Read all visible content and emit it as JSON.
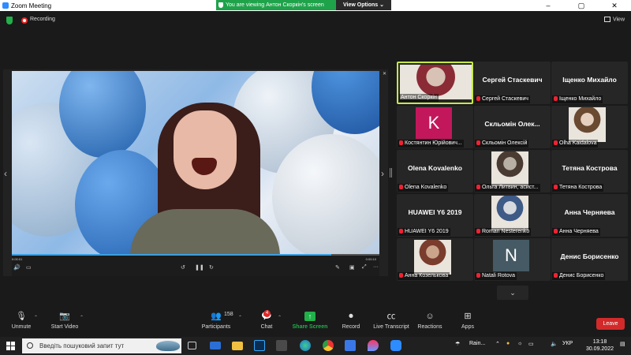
{
  "window": {
    "title": "Zoom Meeting",
    "controls": [
      "–",
      "▢",
      "✕"
    ]
  },
  "share_banner": {
    "text": "You are viewing Антон Скоркін's screen",
    "view_options": "View Options ⌄"
  },
  "topbar": {
    "recording_label": "Recording",
    "view_label": "View"
  },
  "shared_video": {
    "time_elapsed": "0:00:01",
    "time_total": "0:00:10",
    "progress_fraction": 0.87,
    "colors": {
      "progress": "#3c9fe0"
    }
  },
  "participants": [
    {
      "display": "photo",
      "footer": "Антон Скоркін",
      "active": true
    },
    {
      "display": "name",
      "big_name": "Сергей Стаскевич",
      "footer": "Сергей Стаскевич"
    },
    {
      "display": "name",
      "big_name": "Іщенко Михайло",
      "footer": "Іщенко Михайло"
    },
    {
      "display": "initial",
      "initial": "K",
      "footer": "Костянтин Юрійович...",
      "color": "#c2185b"
    },
    {
      "display": "name",
      "big_name": "Скльомін Олек...",
      "footer": "Скльомін Олексій"
    },
    {
      "display": "photo",
      "footer": "Olha Kaidalova"
    },
    {
      "display": "name",
      "big_name": "Olena Kovalenko",
      "footer": "Olena Kovalenko"
    },
    {
      "display": "photo",
      "footer": "Ольга Литвин, асист..."
    },
    {
      "display": "name",
      "big_name": "Тетяна Кострова",
      "footer": "Тетяна Кострова"
    },
    {
      "display": "name",
      "big_name": "HUAWEI Y6 2019",
      "footer": "HUAWEI Y6 2019"
    },
    {
      "display": "photo",
      "footer": "Roman Nesterenko"
    },
    {
      "display": "name",
      "big_name": "Анна Черняева",
      "footer": "Анна Черняева"
    },
    {
      "display": "photo",
      "footer": "Анна Козелькова"
    },
    {
      "display": "initial",
      "initial": "N",
      "footer": "Natali Rotova",
      "color": "#455a64"
    },
    {
      "display": "name",
      "big_name": "Денис Борисенко",
      "footer": "Денис Борисенко"
    }
  ],
  "toolbar": {
    "unmute": "Unmute",
    "start_video": "Start Video",
    "participants": "Participants",
    "participants_count": "158",
    "chat": "Chat",
    "chat_badge": "4",
    "share_screen": "Share Screen",
    "record": "Record",
    "live_transcript": "Live Transcript",
    "reactions": "Reactions",
    "apps": "Apps",
    "leave": "Leave"
  },
  "taskbar": {
    "search_placeholder": "Введіть пошуковий запит тут",
    "weather": "Rain...",
    "language": "УКР",
    "time": "13:18",
    "date": "30.09.2022"
  }
}
